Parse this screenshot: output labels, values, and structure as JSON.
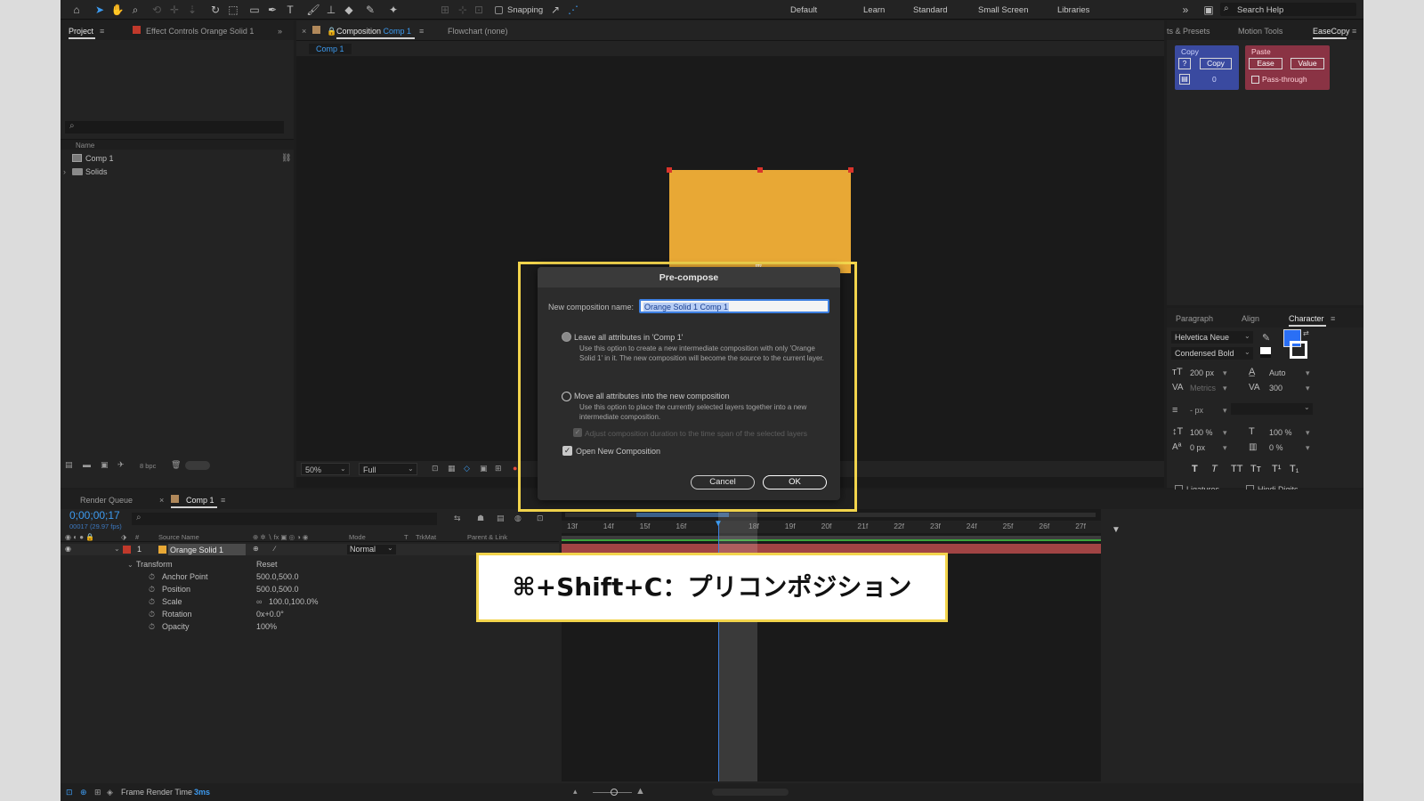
{
  "toolbar": {
    "snapping_label": "Snapping",
    "workspaces": [
      "Default",
      "Learn",
      "Standard",
      "Small Screen",
      "Libraries"
    ],
    "search_placeholder": "Search Help"
  },
  "project_panel": {
    "tab_project": "Project",
    "tab_effect_controls": "Effect Controls Orange Solid 1",
    "column_name": "Name",
    "items": [
      {
        "label": "Comp 1"
      },
      {
        "label": "Solids"
      }
    ],
    "bpc": "8 bpc"
  },
  "composition_panel": {
    "tab_prefix": "Composition",
    "tab_comp": "Comp 1",
    "tab_flowchart": "Flowchart (none)",
    "comp_chip": "Comp 1",
    "zoom": "50%",
    "resolution": "Full",
    "solid_color": "#e8a835"
  },
  "right_panels": {
    "tabs": [
      "ts & Presets",
      "Motion Tools",
      "EaseCopy"
    ],
    "copy_header": "Copy",
    "paste_header": "Paste",
    "copy_q": "?",
    "copy_btn": "Copy",
    "copy_count": "0",
    "ease_btn": "Ease",
    "value_btn": "Value",
    "passthrough": "Pass-through"
  },
  "character_panel": {
    "tabs": [
      "Paragraph",
      "Align",
      "Character"
    ],
    "font_family": "Helvetica Neue",
    "font_style": "Condensed Bold",
    "font_size": "200 px",
    "leading": "Auto",
    "kerning": "Metrics",
    "tracking": "300",
    "stroke_width": "- px",
    "vscale": "100 %",
    "hscale": "100 %",
    "baseline": "0 px",
    "tsume": "0 %",
    "style_buttons": [
      "T",
      "T",
      "TT",
      "Tт",
      "T¹",
      "T₁"
    ],
    "ligatures": "Ligatures",
    "hindi_digits": "Hindi Digits",
    "fill_color": "#2a6ff5"
  },
  "timeline": {
    "tab_render_queue": "Render Queue",
    "tab_comp": "Comp 1",
    "timecode": "0;00;00;17",
    "frames": "00017 (29.97 fps)",
    "col_num": "#",
    "col_source": "Source Name",
    "col_mode": "Mode",
    "col_t": "T",
    "col_trkmat": "TrkMat",
    "col_parent": "Parent & Link",
    "layer_num": "1",
    "layer_name": "Orange Solid 1",
    "layer_mode": "Normal",
    "transform_label": "Transform",
    "transform_reset": "Reset",
    "props": [
      {
        "name": "Anchor Point",
        "value": "500.0,500.0"
      },
      {
        "name": "Position",
        "value": "500.0,500.0"
      },
      {
        "name": "Scale",
        "value": "100.0,100.0%"
      },
      {
        "name": "Rotation",
        "value": "0x+0.0°"
      },
      {
        "name": "Opacity",
        "value": "100%"
      }
    ],
    "ticks": [
      "13f",
      "14f",
      "15f",
      "16f",
      "",
      "18f",
      "19f",
      "20f",
      "21f",
      "22f",
      "23f",
      "24f",
      "25f",
      "26f",
      "27f"
    ],
    "footer_label": "Frame Render Time",
    "footer_value": "3ms"
  },
  "dialog": {
    "title": "Pre-compose",
    "name_label": "New composition name:",
    "name_value": "Orange Solid 1 Comp 1",
    "opt1_label": "Leave all attributes in 'Comp 1'",
    "opt1_desc": "Use this option to create a new intermediate composition with only 'Orange Solid 1' in it. The new composition will become the source to the current layer.",
    "opt2_label": "Move all attributes into the new composition",
    "opt2_desc": "Use this option to place the currently selected layers together into a new intermediate composition.",
    "adjust_label": "Adjust composition duration to the time span of the selected layers",
    "open_label": "Open New Composition",
    "cancel": "Cancel",
    "ok": "OK"
  },
  "caption": "⌘+Shift+C：プリコンポジション"
}
